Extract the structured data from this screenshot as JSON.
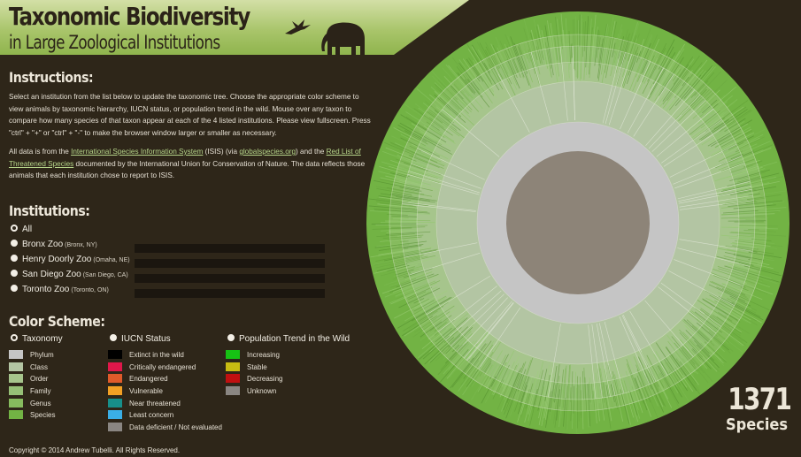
{
  "header": {
    "title_line1": "Taxonomic Biodiversity",
    "title_line2": "in Large Zoological Institutions"
  },
  "instructions": {
    "heading": "Instructions:",
    "para1": "Select an institution from the list below to update the taxonomic tree. Choose the appropriate color scheme to view animals by taxonomic hierarchy, IUCN status, or population trend in the wild. Mouse over any taxon to compare how many species of that taxon appear at each of the 4 listed institutions. Please view fullscreen. Press \"ctrl\" + \"+\" or \"ctrl\" + \"-\" to make the browser window larger or smaller as necessary.",
    "para2_a": "All data is from the ",
    "para2_link1": "International Species Information System",
    "para2_b": " (ISIS) (via ",
    "para2_link2": "globalspecies.org",
    "para2_c": ") and the ",
    "para2_link3": "Red List of Threatened Species",
    "para2_d": " documented by the International Union for Conservation of Nature. The data reflects those animals that each institution chose to report to ISIS."
  },
  "institutions": {
    "heading": "Institutions:",
    "items": [
      {
        "label": "All",
        "location": "",
        "selected": true
      },
      {
        "label": "Bronx Zoo",
        "location": "(Bronx, NY)",
        "selected": false
      },
      {
        "label": "Henry Doorly Zoo",
        "location": "(Omaha, NE)",
        "selected": false
      },
      {
        "label": "San Diego Zoo",
        "location": "(San Diego, CA)",
        "selected": false
      },
      {
        "label": "Toronto Zoo",
        "location": "(Toronto, ON)",
        "selected": false
      }
    ]
  },
  "color_scheme": {
    "heading": "Color Scheme:",
    "taxonomy": {
      "label": "Taxonomy",
      "selected": true,
      "items": [
        {
          "label": "Phylum",
          "color": "#c5c5c5"
        },
        {
          "label": "Class",
          "color": "#b3c5a3"
        },
        {
          "label": "Order",
          "color": "#a6c58c"
        },
        {
          "label": "Family",
          "color": "#96c077"
        },
        {
          "label": "Genus",
          "color": "#86bb5e"
        },
        {
          "label": "Species",
          "color": "#72b344"
        }
      ]
    },
    "iucn": {
      "label": "IUCN Status",
      "selected": false,
      "items": [
        {
          "label": "Extinct in the wild",
          "color": "#000000"
        },
        {
          "label": "Critically endangered",
          "color": "#e0174a"
        },
        {
          "label": "Endangered",
          "color": "#e05a2a"
        },
        {
          "label": "Vulnerable",
          "color": "#f2a024"
        },
        {
          "label": "Near threatened",
          "color": "#178f8a"
        },
        {
          "label": "Least concern",
          "color": "#3aaee6"
        },
        {
          "label": "Data deficient / Not evaluated",
          "color": "#8a8682"
        }
      ]
    },
    "trend": {
      "label": "Population Trend in the Wild",
      "selected": false,
      "items": [
        {
          "label": "Increasing",
          "color": "#16c214"
        },
        {
          "label": "Stable",
          "color": "#c8bc12"
        },
        {
          "label": "Decreasing",
          "color": "#c01010"
        },
        {
          "label": "Unknown",
          "color": "#8a8682"
        }
      ]
    }
  },
  "summary": {
    "count": "1371",
    "count_label": "Species"
  },
  "footer": {
    "copyright": "Copyright © 2014 Andrew Tubelli. All Rights Reserved."
  },
  "colors": {
    "background": "#2e2619",
    "header_green": "#a9c56b",
    "center": "#8d8478",
    "ring_phylum": "#c5c5c5"
  }
}
